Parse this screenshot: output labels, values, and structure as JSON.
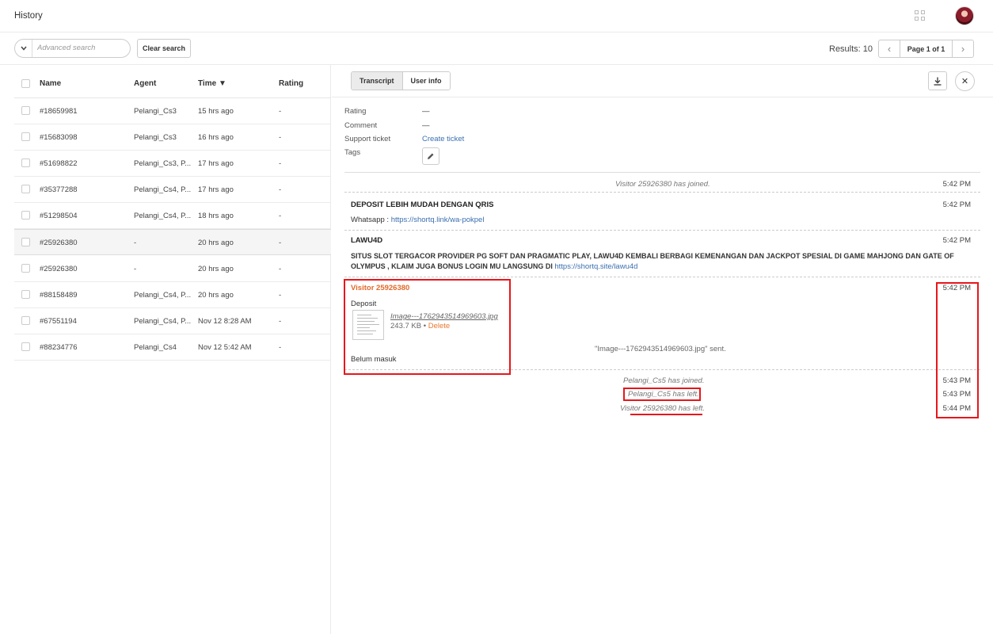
{
  "app": {
    "title": "History"
  },
  "search": {
    "placeholder": "Advanced search",
    "clear_label": "Clear search"
  },
  "results": {
    "label": "Results: 10",
    "page_label": "Page 1 of 1",
    "prev": "‹",
    "next": "›"
  },
  "list": {
    "headers": {
      "name": "Name",
      "agent": "Agent",
      "time": "Time ▼",
      "rating": "Rating"
    },
    "rows": [
      {
        "name": "#18659981",
        "agent": "Pelangi_Cs3",
        "time": "15 hrs ago",
        "rating": "-"
      },
      {
        "name": "#15683098",
        "agent": "Pelangi_Cs3",
        "time": "16 hrs ago",
        "rating": "-"
      },
      {
        "name": "#51698822",
        "agent": "Pelangi_Cs3, P...",
        "time": "17 hrs ago",
        "rating": "-"
      },
      {
        "name": "#35377288",
        "agent": "Pelangi_Cs4, P...",
        "time": "17 hrs ago",
        "rating": "-"
      },
      {
        "name": "#51298504",
        "agent": "Pelangi_Cs4, P...",
        "time": "18 hrs ago",
        "rating": "-"
      },
      {
        "name": "#25926380",
        "agent": "-",
        "time": "20 hrs ago",
        "rating": "-"
      },
      {
        "name": "#25926380",
        "agent": "-",
        "time": "20 hrs ago",
        "rating": "-"
      },
      {
        "name": "#88158489",
        "agent": "Pelangi_Cs4, P...",
        "time": "20 hrs ago",
        "rating": "-"
      },
      {
        "name": "#67551194",
        "agent": "Pelangi_Cs4, P...",
        "time": "Nov 12 8:28 AM",
        "rating": "-"
      },
      {
        "name": "#88234776",
        "agent": "Pelangi_Cs4",
        "time": "Nov 12 5:42 AM",
        "rating": "-"
      }
    ]
  },
  "detail": {
    "tabs": [
      "Transcript",
      "User info"
    ],
    "close_symbol": "✕",
    "meta": {
      "rating_label": "Rating",
      "rating_value": "—",
      "comment_label": "Comment",
      "comment_value": "—",
      "support_label": "Support ticket",
      "support_value": "Create ticket",
      "tags_label": "Tags"
    },
    "transcript": {
      "event1": "Visitor 25926380 has joined.",
      "event1_time": "5:42 PM",
      "msg1_sender": "DEPOSIT LEBIH MUDAH DENGAN QRIS",
      "msg1_time": "5:42 PM",
      "msg1_prefix": "Whatsapp : ",
      "msg1_link": "https://shortq.link/wa-pokpel",
      "msg2_sender": "LAWU4D",
      "msg2_time": "5:42 PM",
      "msg2_line1": "SITUS SLOT TERGACOR PROVIDER PG SOFT DAN PRAGMATIC PLAY, LAWU4D KEMBALI BERBAGI KEMENANGAN DAN JACKPOT SPESIAL DI GAME MAHJONG DAN GATE OF",
      "msg2_line2": "OLYMPUS , KLAIM JUGA BONUS LOGIN MU LANGSUNG DI ",
      "msg2_link": "https://shortq.site/lawu4d",
      "visitor_name": "Visitor 25926380",
      "visitor_time": "5:42 PM",
      "visitor_msg": "Deposit",
      "file_name": "Image---1762943514969603.jpg",
      "file_size": "243.7 KB",
      "file_sep": "•",
      "file_delete": "Delete",
      "file_sent": "\"Image---1762943514969603.jpg\" sent.",
      "visitor_msg2": "Belum masuk",
      "event2": "Pelangi_Cs5 has joined.",
      "event2_time": "5:43 PM",
      "event3": "Pelangi_Cs5 has left.",
      "event3_time": "5:43 PM",
      "event4": "Visitor 25926380 has left.",
      "event4_time": "5:44 PM"
    }
  },
  "colors": {
    "highlight": "#e8161b",
    "link": "#3a6fb0",
    "visitor": "#e06a2b",
    "delete": "#e8782f"
  },
  "icons": [
    "grid-icon",
    "avatar",
    "chevron-down-icon",
    "chevron-left-icon",
    "chevron-right-icon",
    "download-icon",
    "close-icon",
    "pencil-icon"
  ]
}
